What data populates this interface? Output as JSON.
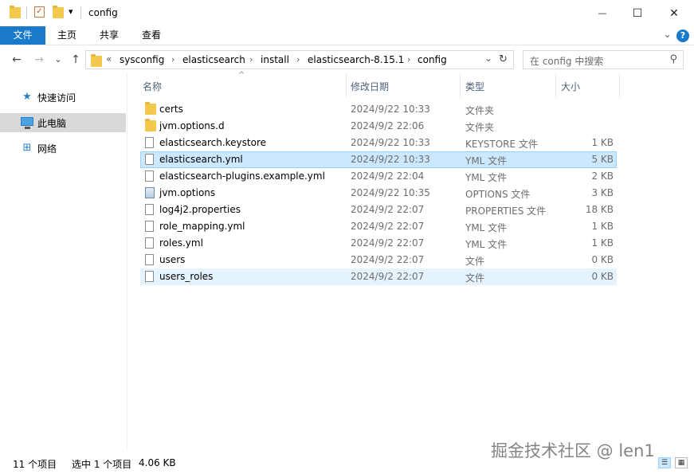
{
  "window": {
    "title": "config",
    "minimize_glyph": "—",
    "maximize_glyph": "☐",
    "close_glyph": "✕"
  },
  "quick_access_toolbar": {
    "check_glyph": "✓",
    "dropdown_glyph": "▾"
  },
  "ribbon": {
    "tabs": [
      "文件",
      "主页",
      "共享",
      "查看"
    ],
    "expand_glyph": "⌄",
    "help_glyph": "?"
  },
  "navigation": {
    "back_glyph": "←",
    "forward_glyph": "→",
    "recent_glyph": "⌄",
    "up_glyph": "↑",
    "overflow_glyph": "«",
    "breadcrumbs": [
      "sysconfig",
      "elasticsearch",
      "install",
      "elasticsearch-8.15.1",
      "config"
    ],
    "crumb_separator": "›",
    "dropdown_glyph": "⌄",
    "refresh_glyph": "↻"
  },
  "search": {
    "placeholder": "在 config 中搜索",
    "icon_glyph": "⚲"
  },
  "sidebar": {
    "items": [
      {
        "label": "快速访问",
        "icon": "star-icon",
        "glyph": "★"
      },
      {
        "label": "此电脑",
        "icon": "computer-icon",
        "glyph": ""
      },
      {
        "label": "网络",
        "icon": "network-icon",
        "glyph": "⊞"
      }
    ]
  },
  "columns": {
    "name": "名称",
    "date": "修改日期",
    "type": "类型",
    "size": "大小",
    "sort_glyph": "^"
  },
  "files": [
    {
      "name": "certs",
      "date": "2024/9/22 10:33",
      "type": "文件夹",
      "size": "",
      "icon": "folder-icon"
    },
    {
      "name": "jvm.options.d",
      "date": "2024/9/2 22:06",
      "type": "文件夹",
      "size": "",
      "icon": "folder-icon"
    },
    {
      "name": "elasticsearch.keystore",
      "date": "2024/9/22 10:33",
      "type": "KEYSTORE 文件",
      "size": "1 KB",
      "icon": "document-icon"
    },
    {
      "name": "elasticsearch.yml",
      "date": "2024/9/22 10:33",
      "type": "YML 文件",
      "size": "5 KB",
      "icon": "document-icon"
    },
    {
      "name": "elasticsearch-plugins.example.yml",
      "date": "2024/9/2 22:04",
      "type": "YML 文件",
      "size": "2 KB",
      "icon": "document-icon"
    },
    {
      "name": "jvm.options",
      "date": "2024/9/22 10:35",
      "type": "OPTIONS 文件",
      "size": "3 KB",
      "icon": "config-file-icon"
    },
    {
      "name": "log4j2.properties",
      "date": "2024/9/2 22:07",
      "type": "PROPERTIES 文件",
      "size": "18 KB",
      "icon": "document-icon"
    },
    {
      "name": "role_mapping.yml",
      "date": "2024/9/2 22:07",
      "type": "YML 文件",
      "size": "1 KB",
      "icon": "document-icon"
    },
    {
      "name": "roles.yml",
      "date": "2024/9/2 22:07",
      "type": "YML 文件",
      "size": "1 KB",
      "icon": "document-icon"
    },
    {
      "name": "users",
      "date": "2024/9/2 22:07",
      "type": "文件",
      "size": "0 KB",
      "icon": "document-icon"
    },
    {
      "name": "users_roles",
      "date": "2024/9/2 22:07",
      "type": "文件",
      "size": "0 KB",
      "icon": "document-icon"
    }
  ],
  "status": {
    "item_count": "11 个项目",
    "selection": "选中 1 个项目",
    "selection_size": "4.06 KB",
    "details_view_glyph": "☰",
    "icons_view_glyph": "▦"
  },
  "watermark": "掘金技术社区 @ len1",
  "colors": {
    "accent": "#1979ca",
    "selection_bg": "#cce8ff",
    "selection_border": "#99d1ff",
    "hover_bg": "#e5f3ff",
    "folder": "#f3c84b"
  }
}
